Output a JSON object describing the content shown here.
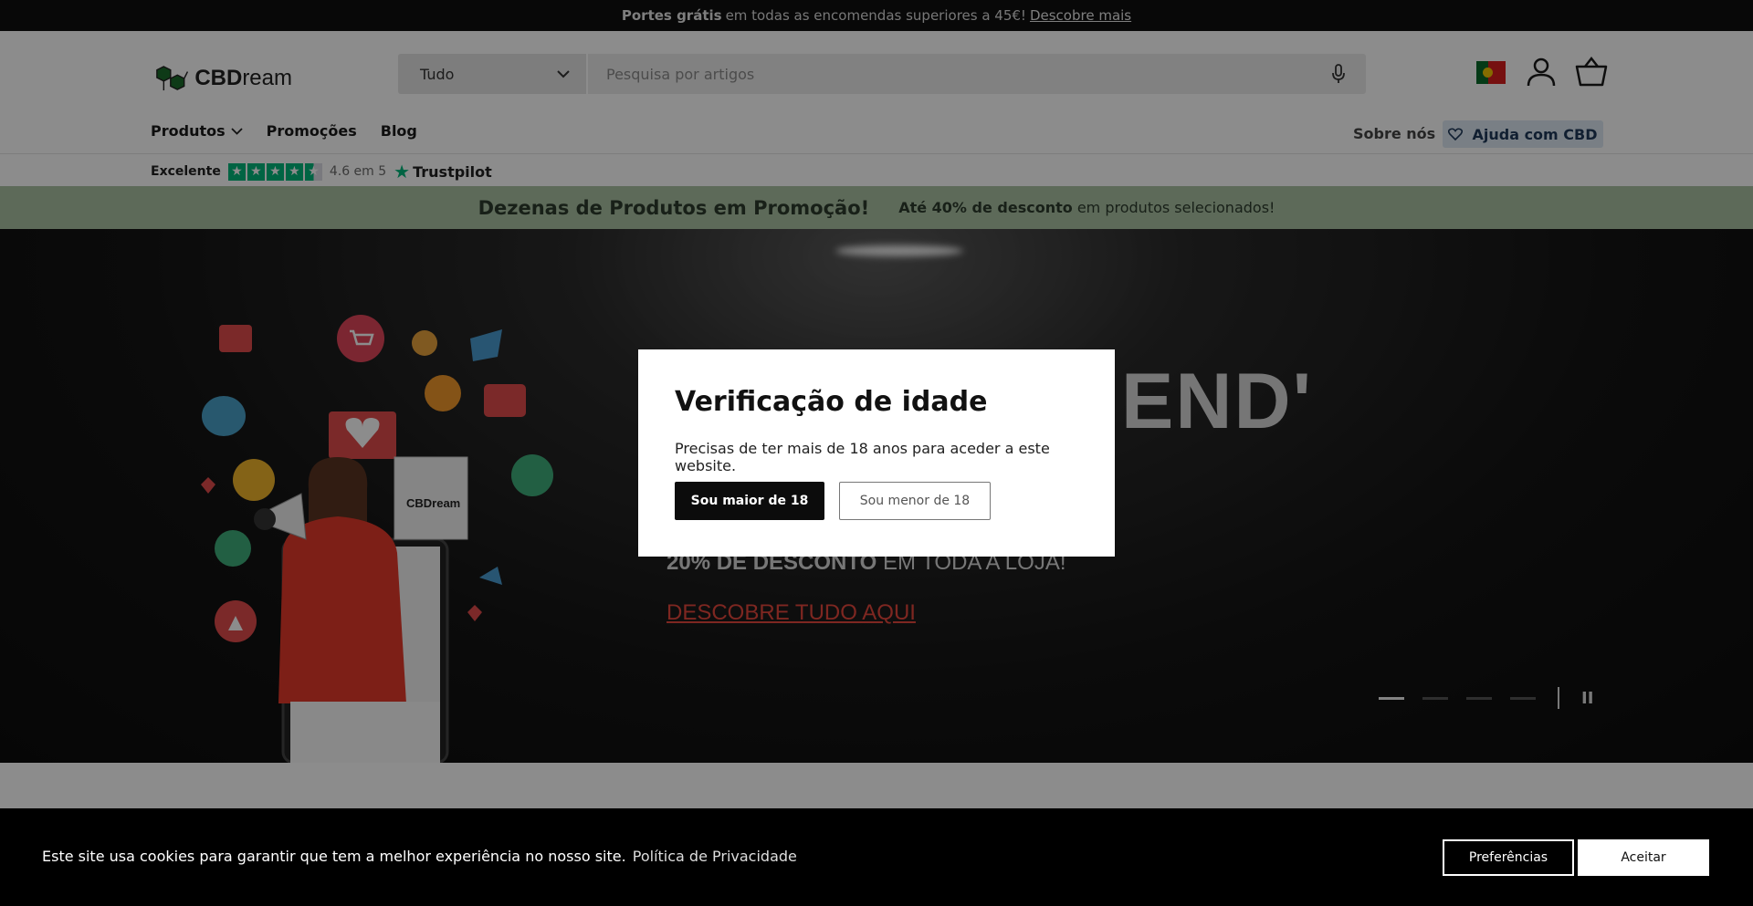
{
  "announcement": {
    "bold": "Portes grátis",
    "text": "em todas as encomendas superiores a 45€!",
    "link": "Descobre mais"
  },
  "header": {
    "logo_bold": "CBD",
    "logo_light": "ream",
    "search": {
      "category": "Tudo",
      "placeholder": "Pesquisa por artigos"
    },
    "icons": [
      "portugal-flag-icon",
      "account-icon",
      "cart-icon",
      "microphone-icon",
      "chevron-down-icon"
    ]
  },
  "nav": {
    "products": "Produtos",
    "promotions": "Promoções",
    "blog": "Blog",
    "about": "Sobre nós",
    "help": "Ajuda com CBD"
  },
  "trustpilot": {
    "label": "Excelente",
    "score": "4.6 em 5",
    "brand": "Trustpilot",
    "rating": 4.6
  },
  "promo_bar": {
    "title": "Dezenas de Produtos em Promoção!",
    "sub_bold": "Até 40% de desconto",
    "sub_text": "em produtos selecionados!"
  },
  "hero": {
    "heading": "END'",
    "line_bold": "20% DE DESCONTO",
    "line_text": "EM TODA A LOJA!",
    "link": "DESCOBRE TUDO AQUI",
    "bag_logo": "CBDream",
    "slide_count": 4,
    "active_slide": 1,
    "pause_glyph": "II"
  },
  "age_modal": {
    "title": "Verificação de idade",
    "text": "Precisas de ter mais de 18 anos para aceder a este website.",
    "yes": "Sou maior de 18",
    "no": "Sou menor de 18"
  },
  "cookie": {
    "text": "Este site usa cookies para garantir que tem a melhor experiência no nosso site.",
    "link": "Política de Privacidade",
    "preferences": "Preferências",
    "accept": "Aceitar"
  },
  "colors": {
    "promo_bar": "#a9c1a3",
    "trustpilot_green": "#00b67a",
    "hero_link": "#e5473c",
    "help_bg": "#dce8f3"
  }
}
